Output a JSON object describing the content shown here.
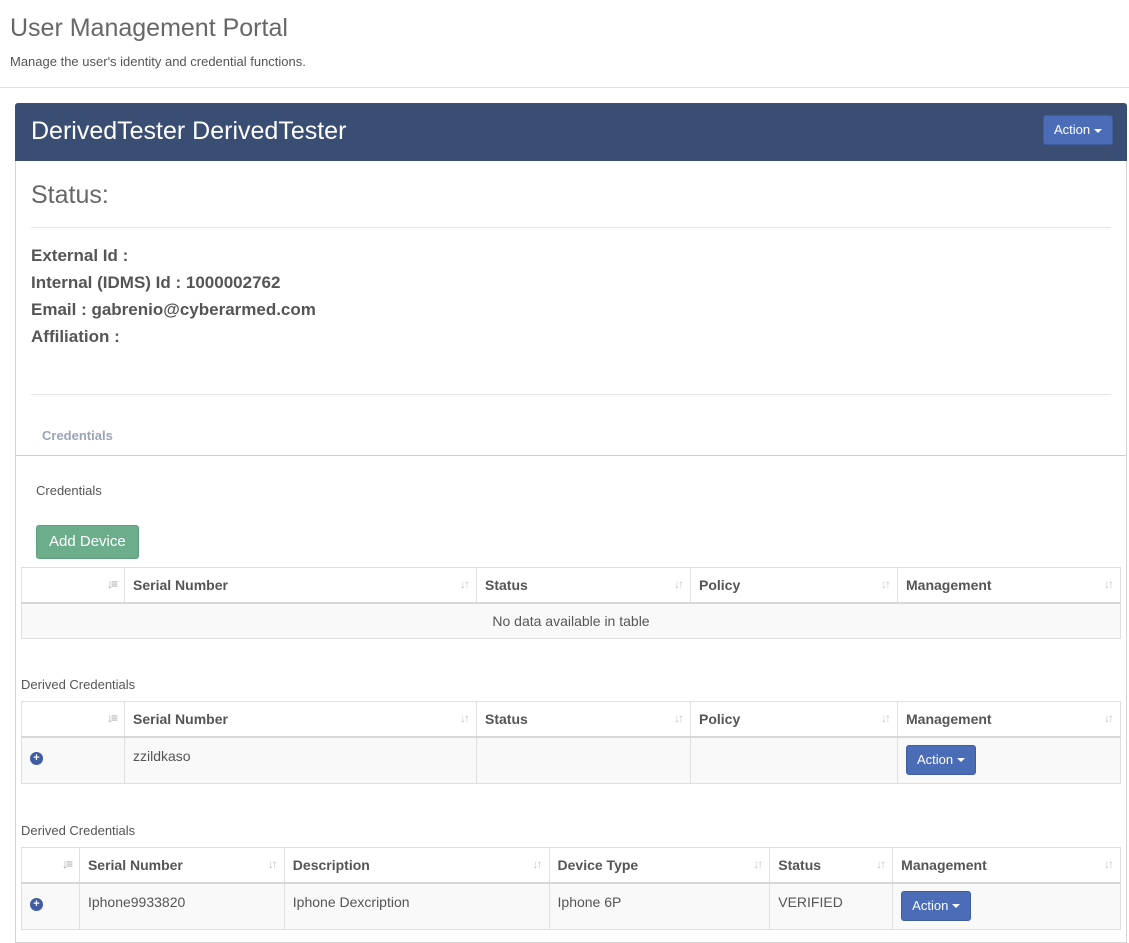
{
  "header": {
    "title": "User Management Portal",
    "subtitle": "Manage the user's identity and credential functions."
  },
  "user_panel": {
    "name": "DerivedTester DerivedTester",
    "action_label": "Action",
    "status_heading": "Status:",
    "external_id": "External Id :",
    "internal_id": "Internal (IDMS) Id : 1000002762",
    "email": "Email : gabrenio@cyberarmed.com",
    "affiliation": "Affiliation :"
  },
  "tabs": {
    "credentials": "Credentials"
  },
  "credentials": {
    "label": "Credentials",
    "add_device": "Add Device",
    "columns": [
      "Serial Number",
      "Status",
      "Policy",
      "Management"
    ],
    "empty": "No data available in table"
  },
  "derived1": {
    "label": "Derived Credentials",
    "columns": [
      "Serial Number",
      "Status",
      "Policy",
      "Management"
    ],
    "rows": [
      {
        "serial": "zzildkaso",
        "status": "",
        "policy": "",
        "action": "Action"
      }
    ]
  },
  "derived2": {
    "label": "Derived Credentials",
    "columns": [
      "Serial Number",
      "Description",
      "Device Type",
      "Status",
      "Management"
    ],
    "rows": [
      {
        "serial": "Iphone9933820",
        "description": "Iphone Dexcription",
        "device_type": "Iphone 6P",
        "status": "VERIFIED",
        "action": "Action"
      }
    ]
  },
  "icons": {
    "sort": "sort-icon",
    "expand": "plus-circle-icon",
    "caret": "caret-down-icon"
  },
  "colors": {
    "panel_header": "#3a4d72",
    "action_button": "#4b6cb7",
    "add_button": "#6cae8c"
  }
}
